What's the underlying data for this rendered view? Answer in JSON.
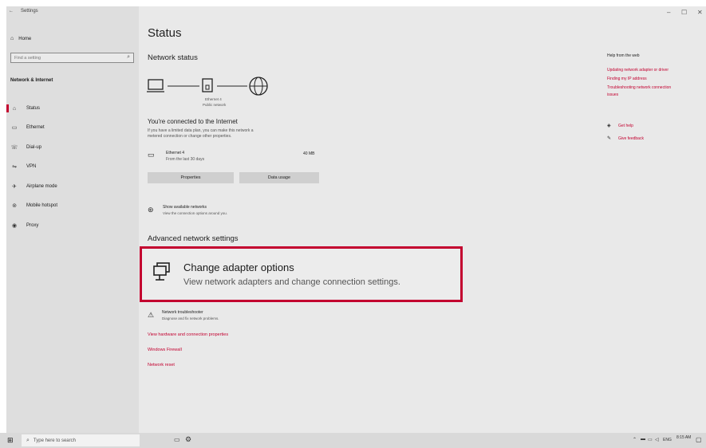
{
  "window": {
    "title": "Settings",
    "back_icon": "back-arrow-icon",
    "minimize": "–",
    "maximize": "☐",
    "close": "✕"
  },
  "sidebar": {
    "home_label": "Home",
    "search_placeholder": "Find a setting",
    "group_title": "Network & Internet",
    "items": [
      {
        "label": "Status",
        "icon": "status-icon",
        "glyph": "⌂"
      },
      {
        "label": "Ethernet",
        "icon": "ethernet-icon",
        "glyph": "▭"
      },
      {
        "label": "Dial-up",
        "icon": "dialup-icon",
        "glyph": "☏"
      },
      {
        "label": "VPN",
        "icon": "vpn-icon",
        "glyph": "⇋"
      },
      {
        "label": "Airplane mode",
        "icon": "airplane-icon",
        "glyph": "✈"
      },
      {
        "label": "Mobile hotspot",
        "icon": "hotspot-icon",
        "glyph": "⊚"
      },
      {
        "label": "Proxy",
        "icon": "proxy-icon",
        "glyph": "◉"
      }
    ]
  },
  "main": {
    "title": "Status",
    "network_status_heading": "Network status",
    "diagram": {
      "device_label_1": "Ethernet 4",
      "device_label_2": "Public network"
    },
    "connected_heading": "You're connected to the Internet",
    "connected_desc_1": "If you have a limited data plan, you can make this network a",
    "connected_desc_2": "metered connection or change other properties.",
    "adapter_name": "Ethernet 4",
    "adapter_sub": "From the last 30 days",
    "adapter_usage": "40 MB",
    "properties_button": "Properties",
    "data_usage_button": "Data usage",
    "show_networks_title": "Show available networks",
    "show_networks_sub": "View the connection options around you.",
    "advanced_heading": "Advanced network settings",
    "change_adapter_title": "Change adapter options",
    "change_adapter_sub": "View network adapters and change connection settings.",
    "troubleshooter_title": "Network troubleshooter",
    "troubleshooter_sub": "Diagnose and fix network problems.",
    "links": [
      "View hardware and connection properties",
      "Windows Firewall",
      "Network reset"
    ]
  },
  "help": {
    "heading": "Help from the web",
    "links": [
      "Updating network adapter or driver",
      "Finding my IP address",
      "Troubleshooting network connection",
      "issues"
    ],
    "get_help": "Get help",
    "give_feedback": "Give feedback"
  },
  "taskbar": {
    "search_placeholder": "Type here to search",
    "tray_lang": "ENG",
    "time": "8:15 AM"
  },
  "colors": {
    "accent": "#c3002f"
  }
}
